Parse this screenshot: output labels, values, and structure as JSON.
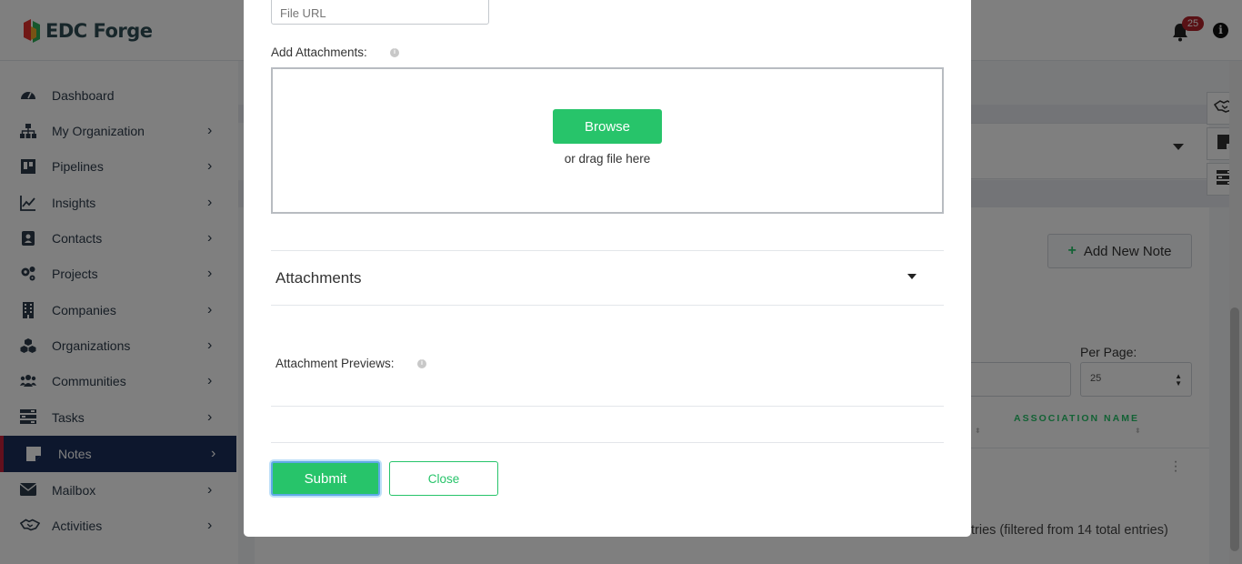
{
  "app": {
    "brand": "EDC Forge"
  },
  "header": {
    "notification_count": "25",
    "info_symbol": "i"
  },
  "sidebar": {
    "items": [
      {
        "label": "Dashboard",
        "icon": "dashboard-icon",
        "has_submenu": false
      },
      {
        "label": "My Organization",
        "icon": "org-chart-icon",
        "has_submenu": true
      },
      {
        "label": "Pipelines",
        "icon": "pipeline-icon",
        "has_submenu": true
      },
      {
        "label": "Insights",
        "icon": "line-chart-icon",
        "has_submenu": true
      },
      {
        "label": "Contacts",
        "icon": "contact-card-icon",
        "has_submenu": true
      },
      {
        "label": "Projects",
        "icon": "cogs-icon",
        "has_submenu": true
      },
      {
        "label": "Companies",
        "icon": "building-icon",
        "has_submenu": true
      },
      {
        "label": "Organizations",
        "icon": "cubes-icon",
        "has_submenu": true
      },
      {
        "label": "Communities",
        "icon": "users-icon",
        "has_submenu": true
      },
      {
        "label": "Tasks",
        "icon": "tasks-icon",
        "has_submenu": true
      },
      {
        "label": "Notes",
        "icon": "sticky-note-icon",
        "has_submenu": true,
        "active": true
      },
      {
        "label": "Mailbox",
        "icon": "envelope-icon",
        "has_submenu": true
      },
      {
        "label": "Activities",
        "icon": "handshake-icon",
        "has_submenu": true
      }
    ],
    "chevron": "›"
  },
  "background": {
    "add_note_label": "Add New Note",
    "per_page_label": "Per Page:",
    "per_page_value": "25",
    "association_header": "ASSOCIATION NAME",
    "entries_text": "tries (filtered from 14 total entries)"
  },
  "modal": {
    "file_url_placeholder": "File URL",
    "add_attachments_label": "Add Attachments:",
    "browse_label": "Browse",
    "drag_text": "or drag file here",
    "attachments_heading": "Attachments",
    "previews_label": "Attachment Previews:",
    "submit_label": "Submit",
    "close_label": "Close"
  },
  "colors": {
    "accent_green": "#27c46a",
    "nav_active_bg": "#1b2e5a",
    "nav_active_marker": "#c7213a",
    "badge": "#b3232a"
  }
}
